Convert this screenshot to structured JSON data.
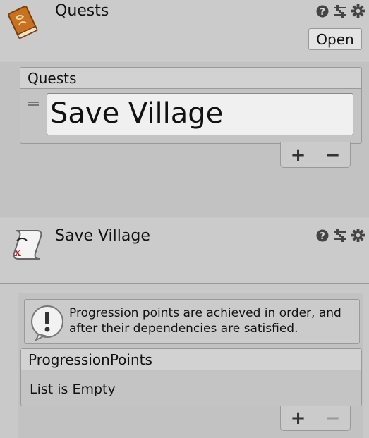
{
  "quests_component": {
    "title": "Quests",
    "open_button": "Open",
    "icons": [
      "book-icon",
      "help-icon",
      "sliders-icon",
      "gear-icon"
    ]
  },
  "quests_list": {
    "header": "Quests",
    "items": [
      {
        "label": "Save Village"
      }
    ],
    "add_label": "+",
    "remove_label": "−"
  },
  "quest_asset": {
    "title": "Save Village",
    "icons": [
      "scroll-icon",
      "help-icon",
      "sliders-icon",
      "gear-icon"
    ]
  },
  "help": {
    "line1": "Progression points are achieved in order, and",
    "line2": "after their dependencies are satisfied."
  },
  "progression_list": {
    "header": "ProgressionPoints",
    "empty_text": "List is Empty",
    "add_label": "+",
    "remove_label": "−"
  }
}
